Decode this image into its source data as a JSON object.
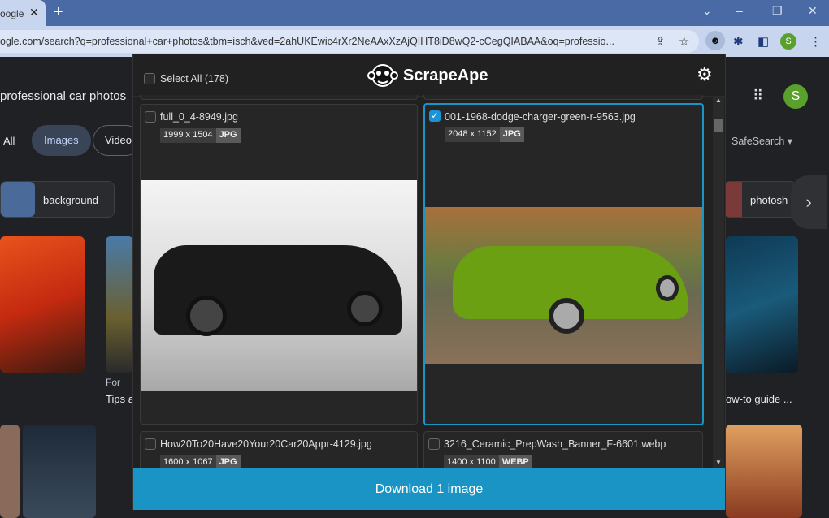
{
  "browser": {
    "tab_title": "oogle",
    "url": "ogle.com/search?q=professional+car+photos&tbm=isch&ved=2ahUKEwic4rXr2NeAAxXzAjQIHT8iD8wQ2-cCegQIABAA&oq=professio...",
    "profile_initial": "S"
  },
  "google": {
    "query": "professional car photos",
    "tabs": [
      "All",
      "Images",
      "Videos"
    ],
    "safesearch": "SafeSearch",
    "chips": [
      "background",
      "photosh"
    ],
    "captions": [
      "For",
      "Tips a",
      "ow-to guide ..."
    ],
    "avatar": "S"
  },
  "popup": {
    "brand": "ScrapeApe",
    "select_all": "Select All (178)",
    "download_label": "Download 1 image",
    "accent": "#1a94c4",
    "images": [
      {
        "name": "full_0_4-8949.jpg",
        "dims": "1999 x 1504",
        "ext": "JPG",
        "selected": false
      },
      {
        "name": "001-1968-dodge-charger-green-r-9563.jpg",
        "dims": "2048 x 1152",
        "ext": "JPG",
        "selected": true
      },
      {
        "name": "How20To20Have20Your20Car20Appr-4129.jpg",
        "dims": "1600 x 1067",
        "ext": "JPG",
        "selected": false
      },
      {
        "name": "3216_Ceramic_PrepWash_Banner_F-6601.webp",
        "dims": "1400 x 1100",
        "ext": "WEBP",
        "selected": false
      }
    ]
  }
}
